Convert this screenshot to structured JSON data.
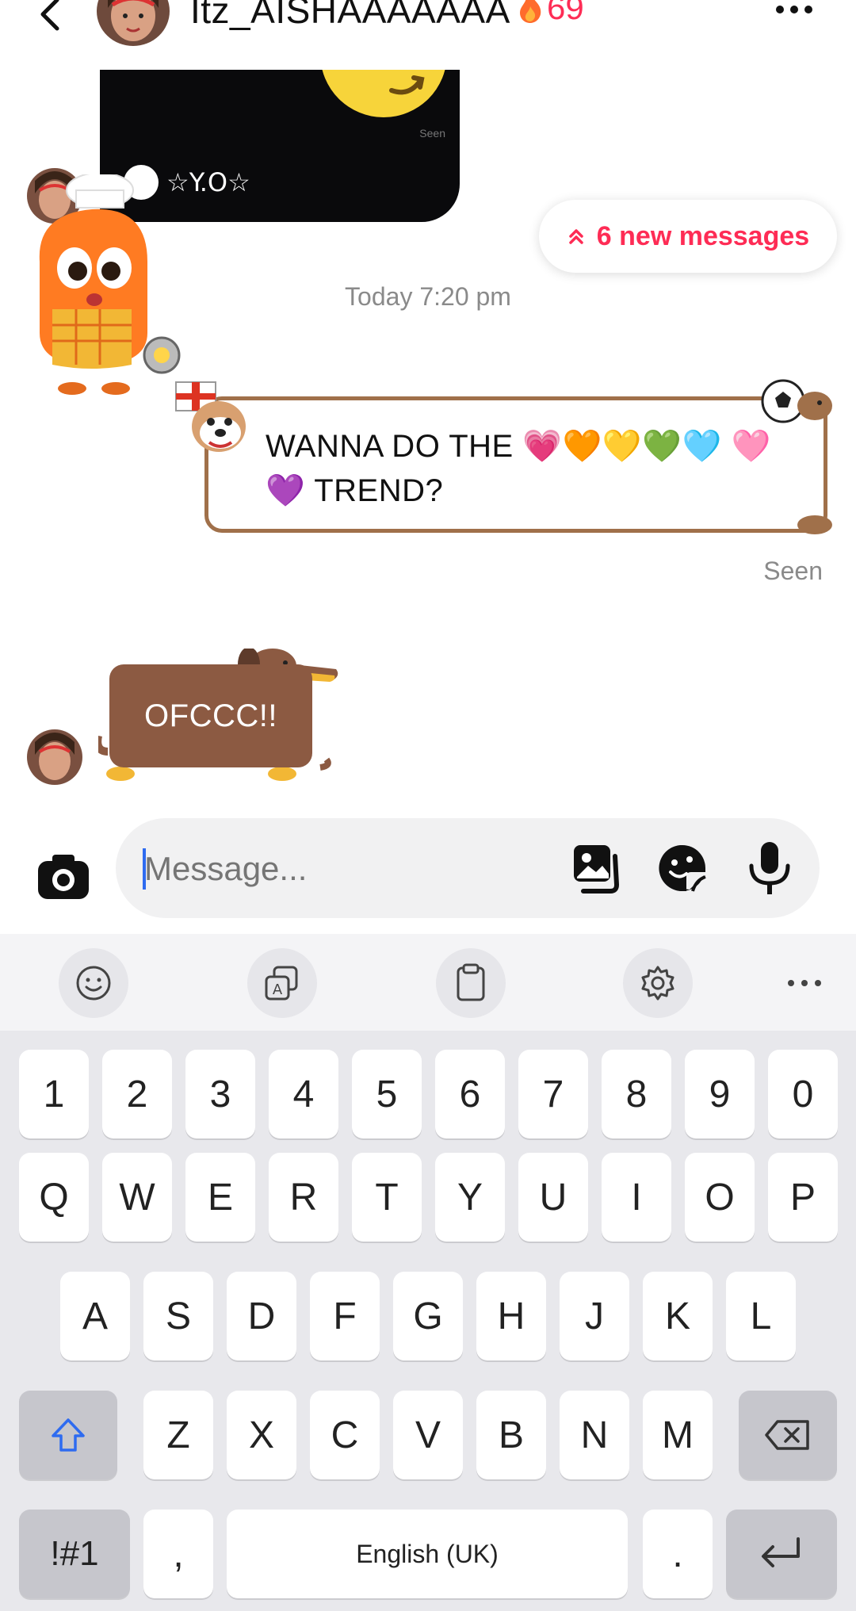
{
  "header": {
    "username": "Itz_AISHAAAAAAA",
    "streak_count": "69",
    "back_icon": "chevron-left-icon",
    "more_icon": "more-dots-icon"
  },
  "chat": {
    "video_card": {
      "seen_text": "Seen",
      "channel_name": "☆Y.O☆"
    },
    "new_messages_label": "6 new messages",
    "timestamp": "Today 7:20 pm",
    "sent_message": "WANNA DO THE 💗🧡💛💚🩵 🩷💜 TREND?",
    "seen_label": "Seen",
    "received_message": "OFCCC!!"
  },
  "composer": {
    "placeholder": "Message..."
  },
  "keyboard": {
    "row_numbers": [
      "1",
      "2",
      "3",
      "4",
      "5",
      "6",
      "7",
      "8",
      "9",
      "0"
    ],
    "row_top": [
      "Q",
      "W",
      "E",
      "R",
      "T",
      "Y",
      "U",
      "I",
      "O",
      "P"
    ],
    "row_middle": [
      "A",
      "S",
      "D",
      "F",
      "G",
      "H",
      "J",
      "K",
      "L"
    ],
    "row_bottom": [
      "Z",
      "X",
      "C",
      "V",
      "B",
      "N",
      "M"
    ],
    "symbols_label": "!#1",
    "comma_label": ",",
    "space_label": "English (UK)",
    "period_label": "."
  },
  "colors": {
    "accent": "#fe2c55",
    "caret": "#2e6bf0",
    "dog_brown": "#8c5a42"
  }
}
